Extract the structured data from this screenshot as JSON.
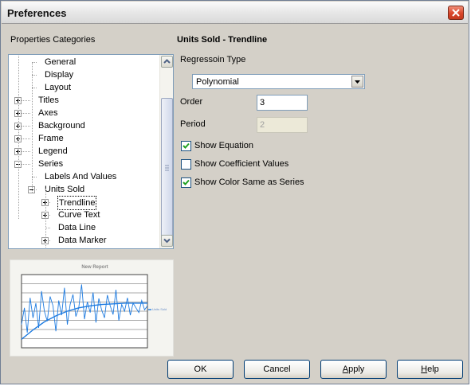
{
  "window": {
    "title": "Preferences"
  },
  "left": {
    "categories_label": "Properties Categories",
    "tree": [
      {
        "label": "General",
        "depth": 1,
        "expander": "none"
      },
      {
        "label": "Display",
        "depth": 1,
        "expander": "none"
      },
      {
        "label": "Layout",
        "depth": 1,
        "expander": "none"
      },
      {
        "label": "Titles",
        "depth": 0,
        "expander": "plus"
      },
      {
        "label": "Axes",
        "depth": 0,
        "expander": "plus"
      },
      {
        "label": "Background",
        "depth": 0,
        "expander": "plus"
      },
      {
        "label": "Frame",
        "depth": 0,
        "expander": "plus"
      },
      {
        "label": "Legend",
        "depth": 0,
        "expander": "plus"
      },
      {
        "label": "Series",
        "depth": 0,
        "expander": "minus"
      },
      {
        "label": "Labels And Values",
        "depth": 1,
        "expander": "none"
      },
      {
        "label": "Units Sold",
        "depth": 1,
        "expander": "minus"
      },
      {
        "label": "Trendline",
        "depth": 2,
        "expander": "plus",
        "selected": true
      },
      {
        "label": "Curve Text",
        "depth": 2,
        "expander": "plus"
      },
      {
        "label": "Data Line",
        "depth": 2,
        "expander": "none"
      },
      {
        "label": "Data Marker",
        "depth": 2,
        "expander": "plus"
      }
    ]
  },
  "preview": {
    "title": "New Report",
    "legend": "Units Sold",
    "line_color": "#1e7be0",
    "values": [
      30,
      55,
      18,
      70,
      40,
      62,
      25,
      80,
      50,
      35,
      72,
      58,
      20,
      66,
      44,
      85,
      30,
      60,
      75,
      42,
      55,
      90,
      38,
      64,
      48,
      78,
      33,
      69,
      52,
      40,
      74,
      58,
      45,
      82,
      36,
      60,
      50,
      70,
      44,
      62,
      55,
      48,
      66,
      52,
      58
    ],
    "trend": [
      8,
      22,
      34,
      43,
      50,
      55,
      58,
      60,
      61,
      62,
      62,
      62
    ]
  },
  "right": {
    "heading": "Units Sold - Trendline",
    "regression_label": "Regressoin Type",
    "regression_value": "Polynomial",
    "order_label": "Order",
    "order_value": "3",
    "period_label": "Period",
    "period_value": "2",
    "checkboxes": [
      {
        "label": "Show Equation",
        "checked": true
      },
      {
        "label": "Show Coefficient Values",
        "checked": false
      },
      {
        "label": "Show Color Same as Series",
        "checked": true
      }
    ]
  },
  "buttons": {
    "ok": "OK",
    "cancel": "Cancel",
    "apply_prefix": "",
    "apply_accel": "A",
    "apply_rest": "pply",
    "help_prefix": "",
    "help_accel": "H",
    "help_rest": "elp"
  }
}
